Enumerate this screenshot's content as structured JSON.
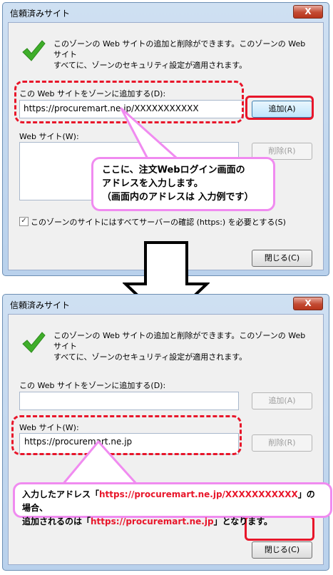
{
  "dialog1": {
    "title": "信頼済みサイト",
    "close": "X",
    "info_line1": "このゾーンの Web サイトの追加と削除ができます。このゾーンの Web サイト",
    "info_line2": "すべてに、ゾーンのセキュリティ設定が適用されます。",
    "add_label": "この Web サイトをゾーンに追加する(D):",
    "add_value": "https://procuremart.ne.jp/XXXXXXXXXXX",
    "add_button": "追加(A)",
    "list_label": "Web サイト(W):",
    "remove_button": "削除(R)",
    "checkbox_label": "このゾーンのサイトにはすべてサーバーの確認 (https:) を必要とする(S)",
    "close_button": "閉じる(C)"
  },
  "callout1": {
    "line1": "ここに、注文Webログイン画面の",
    "line2": "アドレスを入力します。",
    "line3": "（画面内のアドレスは 入力例です）"
  },
  "dialog2": {
    "title": "信頼済みサイト",
    "close": "X",
    "info_line1": "このゾーンの Web サイトの追加と削除ができます。このゾーンの Web サイト",
    "info_line2": "すべてに、ゾーンのセキュリティ設定が適用されます。",
    "add_label": "この Web サイトをゾーンに追加する(D):",
    "add_value": "",
    "add_button": "追加(A)",
    "list_label": "Web サイト(W):",
    "list_items": [
      "https://procuremart.ne.jp"
    ],
    "remove_button": "削除(R)",
    "close_button": "閉じる(C)"
  },
  "callout2": {
    "line1_a": "入力したアドレス「",
    "line1_url": "https://procuremart.ne.jp/XXXXXXXXXXX",
    "line1_b": "」の 場合、",
    "line2_a": "追加されるのは「",
    "line2_url": "https://procuremart.ne.jp",
    "line2_b": "」となります。"
  },
  "colors": {
    "highlight": "#e8162a",
    "callout_border": "#f08bf0",
    "check_green": "#3fae2a"
  }
}
